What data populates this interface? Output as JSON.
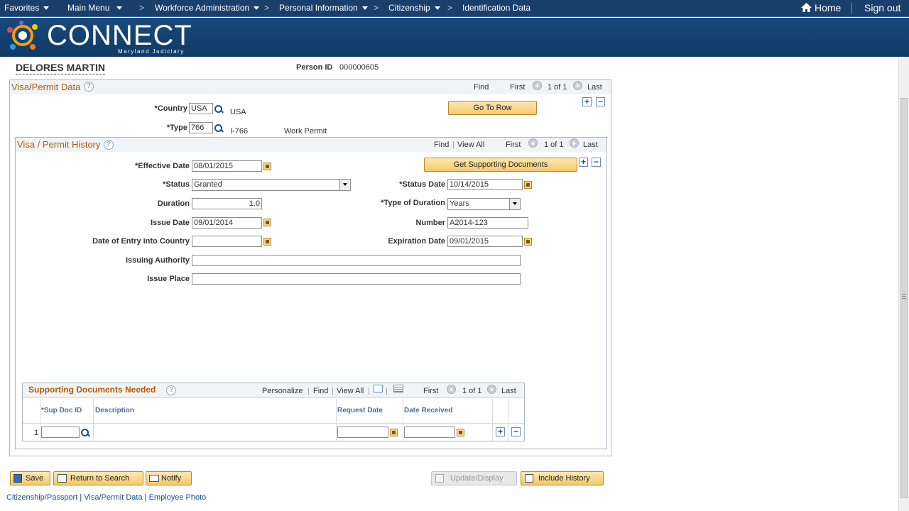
{
  "nav": {
    "favorites": "Favorites",
    "main_menu": "Main Menu",
    "breadcrumb": [
      "Workforce Administration",
      "Personal Information",
      "Citizenship",
      "Identification Data"
    ],
    "home": "Home",
    "sign_out": "Sign out"
  },
  "brand": {
    "name": "CONNECT",
    "subtitle": "Maryland Judiciary"
  },
  "person": {
    "name": "DELORES MARTIN",
    "id_label": "Person ID",
    "id_value": "000000605"
  },
  "visa_section": {
    "title": "Visa/Permit Data",
    "find": "Find",
    "first": "First",
    "count": "1 of 1",
    "last": "Last",
    "go_to_row": "Go To Row",
    "country_label": "*Country",
    "country_value": "USA",
    "country_desc": "USA",
    "type_label": "*Type",
    "type_value": "766",
    "type_code": "I-766",
    "type_desc": "Work Permit"
  },
  "history": {
    "title": "Visa / Permit History",
    "find": "Find",
    "view_all": "View All",
    "first": "First",
    "count": "1 of 1",
    "last": "Last",
    "get_docs": "Get Supporting Documents",
    "effective_date_label": "*Effective Date",
    "effective_date": "08/01/2015",
    "status_label": "*Status",
    "status": "Granted",
    "status_date_label": "*Status Date",
    "status_date": "10/14/2015",
    "duration_label": "Duration",
    "duration": "1.0",
    "type_duration_label": "*Type of Duration",
    "type_duration": "Years",
    "issue_date_label": "Issue Date",
    "issue_date": "09/01/2014",
    "number_label": "Number",
    "number": "A2014-123",
    "entry_label": "Date of Entry into Country",
    "entry_date": "",
    "expiration_label": "Expiration Date",
    "expiration_date": "09/01/2015",
    "authority_label": "Issuing Authority",
    "authority": "",
    "place_label": "Issue Place",
    "place": ""
  },
  "docs": {
    "title": "Supporting Documents Needed",
    "personalize": "Personalize",
    "find": "Find",
    "view_all": "View All",
    "first": "First",
    "count": "1 of 1",
    "last": "Last",
    "columns": [
      "*Sup Doc ID",
      "Description",
      "Request Date",
      "Date Received"
    ],
    "rows": [
      {
        "num": "1",
        "sup_doc_id": "",
        "description": "",
        "request_date": "",
        "date_received": ""
      }
    ]
  },
  "actions": {
    "save": "Save",
    "return": "Return to Search",
    "notify": "Notify",
    "update": "Update/Display",
    "include_history": "Include History"
  },
  "footer_links": [
    "Citizenship/Passport",
    "Visa/Permit Data",
    "Employee Photo"
  ]
}
